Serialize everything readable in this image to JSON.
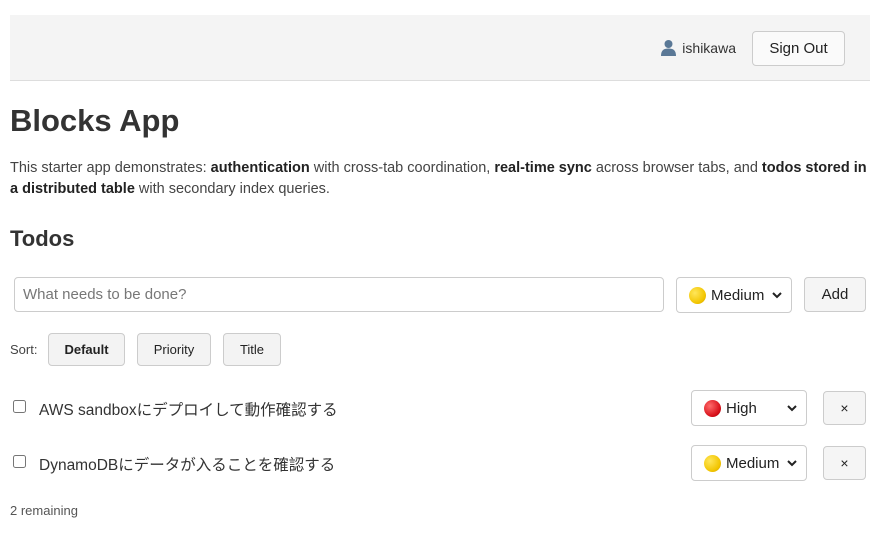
{
  "header": {
    "username": "ishikawa",
    "sign_out_label": "Sign Out"
  },
  "main": {
    "title": "Blocks App",
    "description": {
      "part1": "This starter app demonstrates: ",
      "bold1": "authentication",
      "part2": " with cross-tab coordination, ",
      "bold2": "real-time sync",
      "part3": " across browser tabs, and ",
      "bold3": "todos stored in a distributed table",
      "part4": " with secondary index queries."
    },
    "todos_heading": "Todos"
  },
  "new_todo": {
    "placeholder": "What needs to be done?",
    "priority": "Medium",
    "priority_color": "#f2c500",
    "add_label": "Add"
  },
  "sort": {
    "label": "Sort:",
    "options": [
      "Default",
      "Priority",
      "Title"
    ],
    "active": "Default"
  },
  "todos": [
    {
      "text": "AWS sandboxにデプロイして動作確認する",
      "priority": "High",
      "priority_color": "#d8111a",
      "completed": false,
      "delete_label": "×"
    },
    {
      "text": "DynamoDBにデータが入ることを確認する",
      "priority": "Medium",
      "priority_color": "#f2c500",
      "completed": false,
      "delete_label": "×"
    }
  ],
  "footer": {
    "remaining": "2 remaining"
  }
}
